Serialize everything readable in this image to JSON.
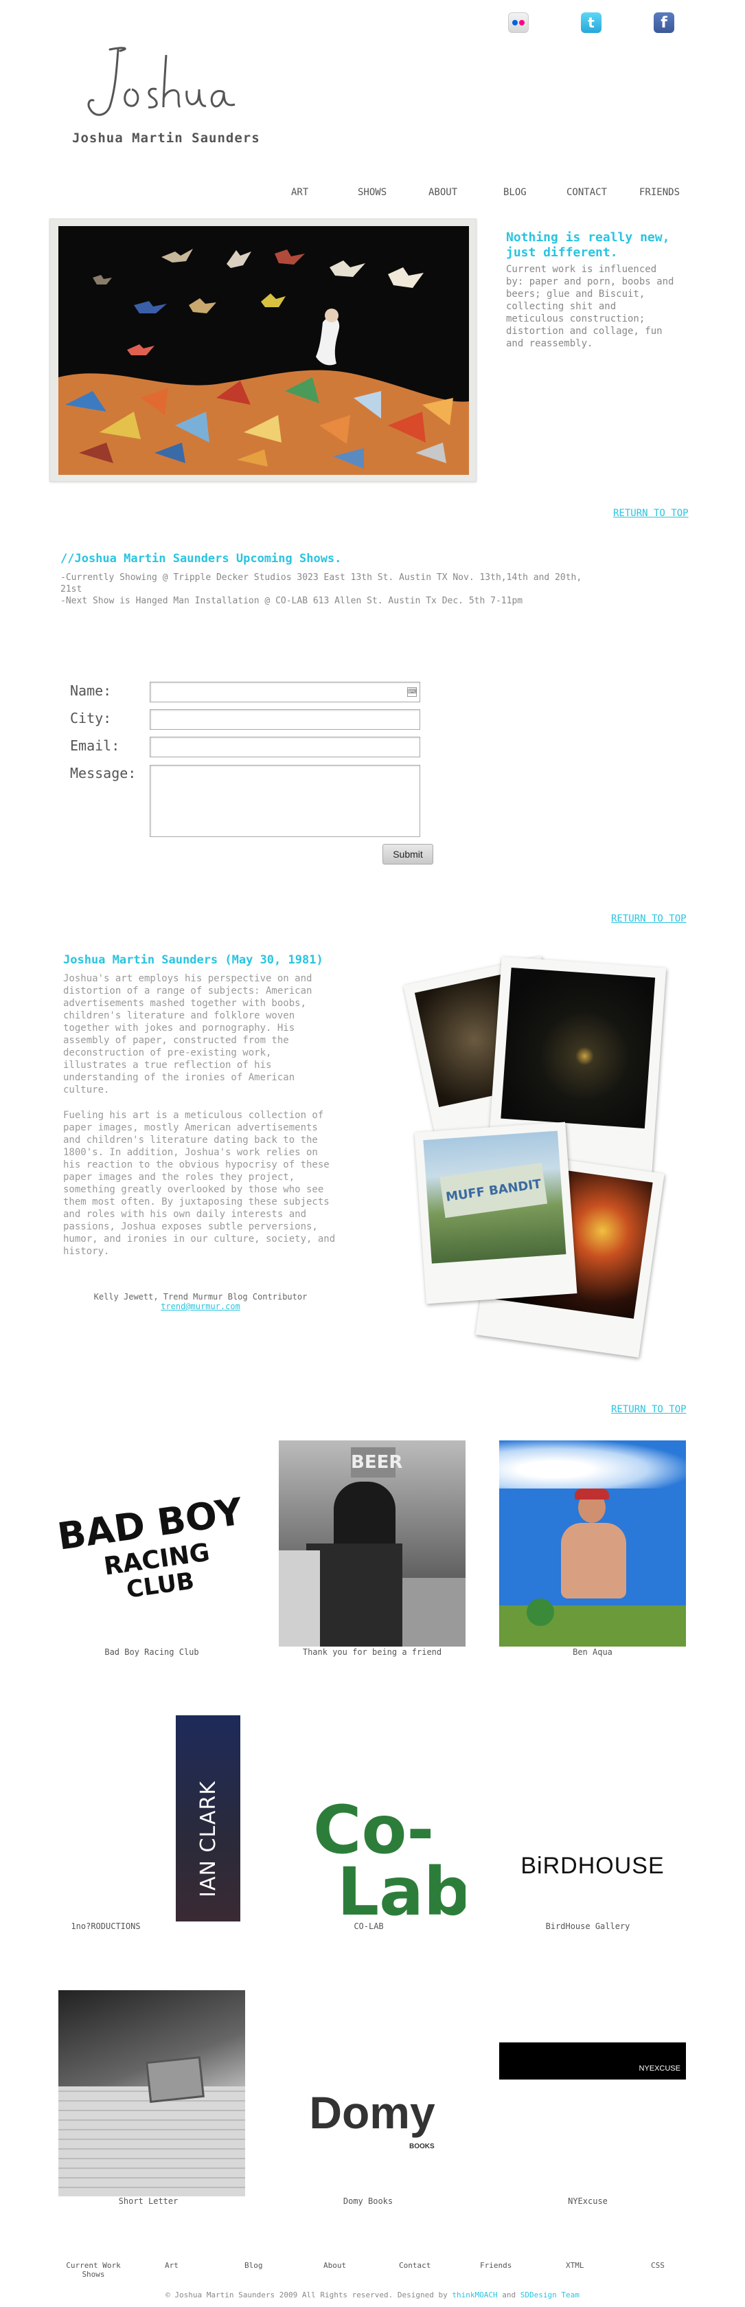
{
  "social": {
    "flickr": "flickr-icon",
    "twitter": "t",
    "facebook": "f"
  },
  "header": {
    "logo_script": "Joshua",
    "name": "Joshua Martin Saunders"
  },
  "nav": [
    "ART",
    "SHOWS",
    "ABOUT",
    "BLOG",
    "CONTACT",
    "FRIENDS"
  ],
  "hero": {
    "tagline_1": "Nothing is really new,",
    "tagline_2": "just different.",
    "description": "Current work is influenced by: paper and porn, boobs and beers; glue and Biscuit, collecting shit and meticulous construction; distortion and collage, fun and reassembly."
  },
  "return_to_top": "RETURN TO TOP",
  "shows": {
    "title": "//Joshua Martin Saunders Upcoming Shows.",
    "line1": "-Currently Showing @ Tripple Decker Studios 3023 East 13th St. Austin TX Nov. 13th,14th and 20th,",
    "line1b": "21st",
    "line2": "-Next Show is Hanged Man Installation @ CO-LAB 613 Allen St. Austin Tx Dec. 5th 7-11pm"
  },
  "form": {
    "name_label": "Name:",
    "city_label": "City:",
    "email_label": "Email:",
    "message_label": "Message:",
    "submit_label": "Submit"
  },
  "bio": {
    "title": "Joshua Martin Saunders (May 30, 1981)",
    "p1": "Joshua's art employs his perspective on and distortion of a range of subjects: American advertisements mashed together with boobs, children's literature and folklore woven together with jokes and pornography. His assembly of paper, constructed from the deconstruction of pre-existing work, illustrates a true reflection of his understanding of the ironies of American culture.",
    "p2": "Fueling his art is a meticulous collection of paper images, mostly American advertisements and children's literature dating back to the 1800's. In addition, Joshua's work relies on his reaction to the obvious hypocrisy of these paper images and the roles they project, something greatly overlooked by those who see them most often. By juxtaposing these subjects and roles with his own daily interests and passions, Joshua exposes subtle perversions, humor, and ironies in our culture, society, and history.",
    "credit": "Kelly Jewett, Trend Murmur Blog Contributor",
    "credit_email": "trend@murmur.com",
    "polaroid_sign": "MUFF BANDIT"
  },
  "friends": [
    {
      "caption": "Bad Boy Racing Club",
      "logo_line1": "BAD BOY",
      "logo_line2": "RACING",
      "logo_line3": "CLUB"
    },
    {
      "caption": "Thank you for being a friend",
      "sign": "BEER"
    },
    {
      "caption": "Ben Aqua"
    },
    {
      "caption": "1no?RODUCTIONS",
      "banner": "IAN CLARK"
    },
    {
      "caption": "CO-LAB",
      "logo_top": "Co-",
      "logo_bottom": "Lab"
    },
    {
      "caption": "BirdHouse Gallery",
      "logo": "BiRDHOUSE"
    },
    {
      "caption": "Short Letter"
    },
    {
      "caption": "Domy Books",
      "logo": "Domy",
      "logo_sub": "BOOKS"
    },
    {
      "caption": "NYExcuse",
      "logo": "NYEXCUSE"
    }
  ],
  "footer": {
    "nav": [
      "Current Work",
      "Shows",
      "Art",
      "Blog",
      "About",
      "Contact",
      "Friends",
      "XTML",
      "CSS"
    ],
    "copyright_pre": "© Joshua Martin Saunders 2009 All Rights reserved. Designed by ",
    "designer1": "thinkMOACH",
    "and": " and ",
    "designer2": "SDDesign Team"
  },
  "colors": {
    "accent": "#29c4e0",
    "text": "#888888",
    "dark": "#555555"
  }
}
